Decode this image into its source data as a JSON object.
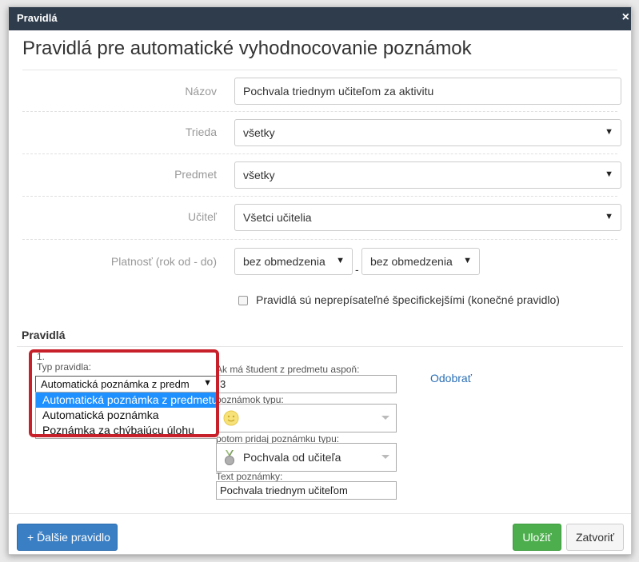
{
  "dialog": {
    "title": "Pravidlá",
    "close_glyph": "×",
    "heading": "Pravidlá pre automatické vyhodnocovanie poznámok"
  },
  "form": {
    "name": {
      "label": "Názov",
      "value": "Pochvala triednym učiteľom za aktivitu"
    },
    "class": {
      "label": "Trieda",
      "value": "všetky"
    },
    "subject": {
      "label": "Predmet",
      "value": "všetky"
    },
    "teacher": {
      "label": "Učiteľ",
      "value": "Všetci učitelia"
    },
    "validity": {
      "label": "Platnosť (rok od - do)",
      "from": "bez obmedzenia",
      "separator": "-",
      "to": "bez obmedzenia"
    },
    "final_rule": {
      "label": "Pravidlá sú neprepísateľné špecifickejšími (konečné pravidlo)",
      "checked": false
    }
  },
  "rules": {
    "section_title": "Pravidlá",
    "items": [
      {
        "number": "1.",
        "type_label": "Typ pravidla:",
        "type_value": "Automatická poznámka z predm",
        "type_options": [
          "Automatická poznámka z predmetu",
          "Automatická poznámka",
          "Poznámka za chýbajúcu úlohu"
        ],
        "selected_option": 0,
        "condition_label": "Ak má študent z predmetu aspoň:",
        "condition_value": "3",
        "notes_type_label": "poznámok typu:",
        "notes_type_icon": "smiley-icon",
        "then_label": "potom pridaj poznámku typu:",
        "then_value": "Pochvala od učiteľa",
        "then_icon": "medal-icon",
        "text_label": "Text poznámky:",
        "text_value": "Pochvala triednym učiteľom",
        "remove_label": "Odobrať"
      }
    ]
  },
  "footer": {
    "add_rule_label": "+ Ďalšie pravidlo",
    "save_label": "Uložiť",
    "close_label": "Zatvoriť"
  },
  "colors": {
    "titlebar": "#2f3c4c",
    "primary": "#3a7fc4",
    "success": "#4cae4c",
    "highlight": "#c8202a",
    "link": "#2a6fb5"
  }
}
